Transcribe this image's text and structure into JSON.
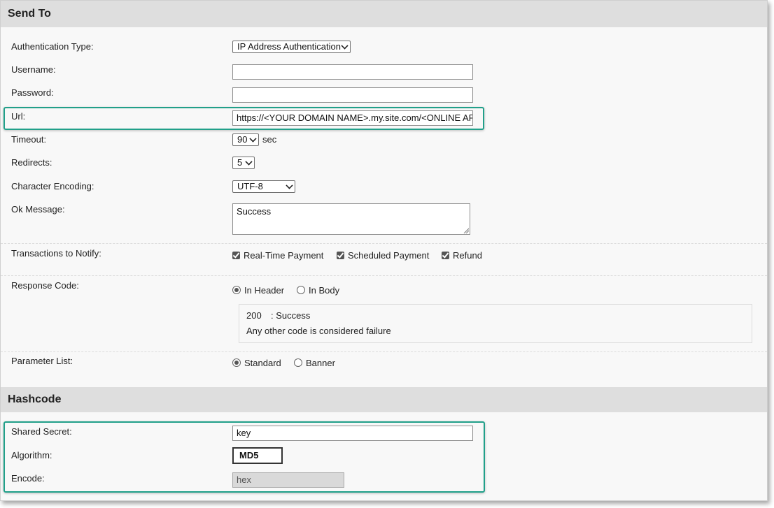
{
  "send_to": {
    "title": "Send To",
    "authentication_type": {
      "label": "Authentication Type:",
      "value": "IP Address Authentication"
    },
    "username": {
      "label": "Username:",
      "value": ""
    },
    "password": {
      "label": "Password:",
      "value": ""
    },
    "url": {
      "label": "Url:",
      "value": "https://<YOUR DOMAIN NAME>.my.site.com/<ONLINE APP"
    },
    "timeout": {
      "label": "Timeout:",
      "value": "90",
      "unit": "sec"
    },
    "redirects": {
      "label": "Redirects:",
      "value": "5"
    },
    "character_encoding": {
      "label": "Character Encoding:",
      "value": "UTF-8"
    },
    "ok_message": {
      "label": "Ok Message:",
      "value": "Success"
    },
    "transactions": {
      "label": "Transactions to Notify:",
      "options": [
        {
          "label": "Real-Time Payment",
          "checked": true
        },
        {
          "label": "Scheduled Payment",
          "checked": true
        },
        {
          "label": "Refund",
          "checked": true
        }
      ]
    },
    "response_code": {
      "label": "Response Code:",
      "options": [
        {
          "label": "In Header",
          "selected": true
        },
        {
          "label": "In Body",
          "selected": false
        }
      ],
      "info": {
        "code": "200",
        "code_text": ": Success",
        "note": "Any other code is considered failure"
      }
    },
    "parameter_list": {
      "label": "Parameter List:",
      "options": [
        {
          "label": "Standard",
          "selected": true
        },
        {
          "label": "Banner",
          "selected": false
        }
      ]
    }
  },
  "hashcode": {
    "title": "Hashcode",
    "shared_secret": {
      "label": "Shared Secret:",
      "value": "key"
    },
    "algorithm": {
      "label": "Algorithm:",
      "value": "MD5"
    },
    "encode": {
      "label": "Encode:",
      "value": "hex"
    }
  },
  "colors": {
    "highlight": "#21a08a",
    "section_header": "#dedede"
  }
}
